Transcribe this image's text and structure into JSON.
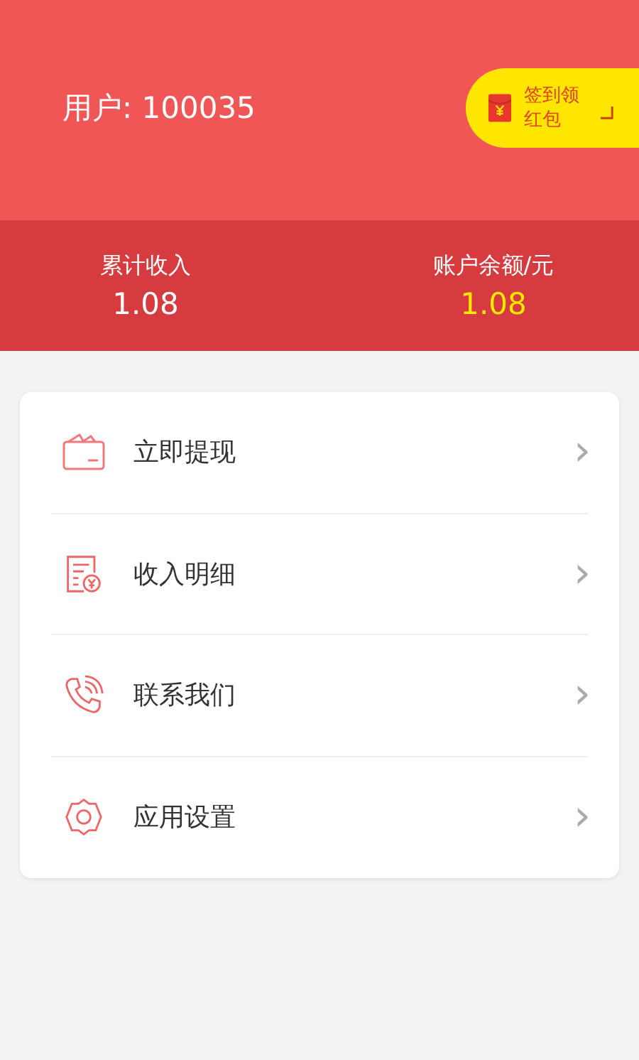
{
  "header": {
    "user_label": "用户: 100035",
    "signin_badge": {
      "line_1": "签到领",
      "line_2": "红包"
    }
  },
  "stats": [
    {
      "label": "累计收入",
      "value": "1.08",
      "highlight": false
    },
    {
      "label": "账户余额/元",
      "value": "1.08",
      "highlight": true
    }
  ],
  "menu": [
    {
      "kind": "wallet",
      "label": "立即提现",
      "chevron": "›"
    },
    {
      "kind": "bill",
      "label": "收入明细",
      "chevron": "›"
    },
    {
      "kind": "phone",
      "label": "联系我们",
      "chevron": "›"
    },
    {
      "kind": "gear",
      "label": "应用设置",
      "chevron": "›"
    }
  ]
}
